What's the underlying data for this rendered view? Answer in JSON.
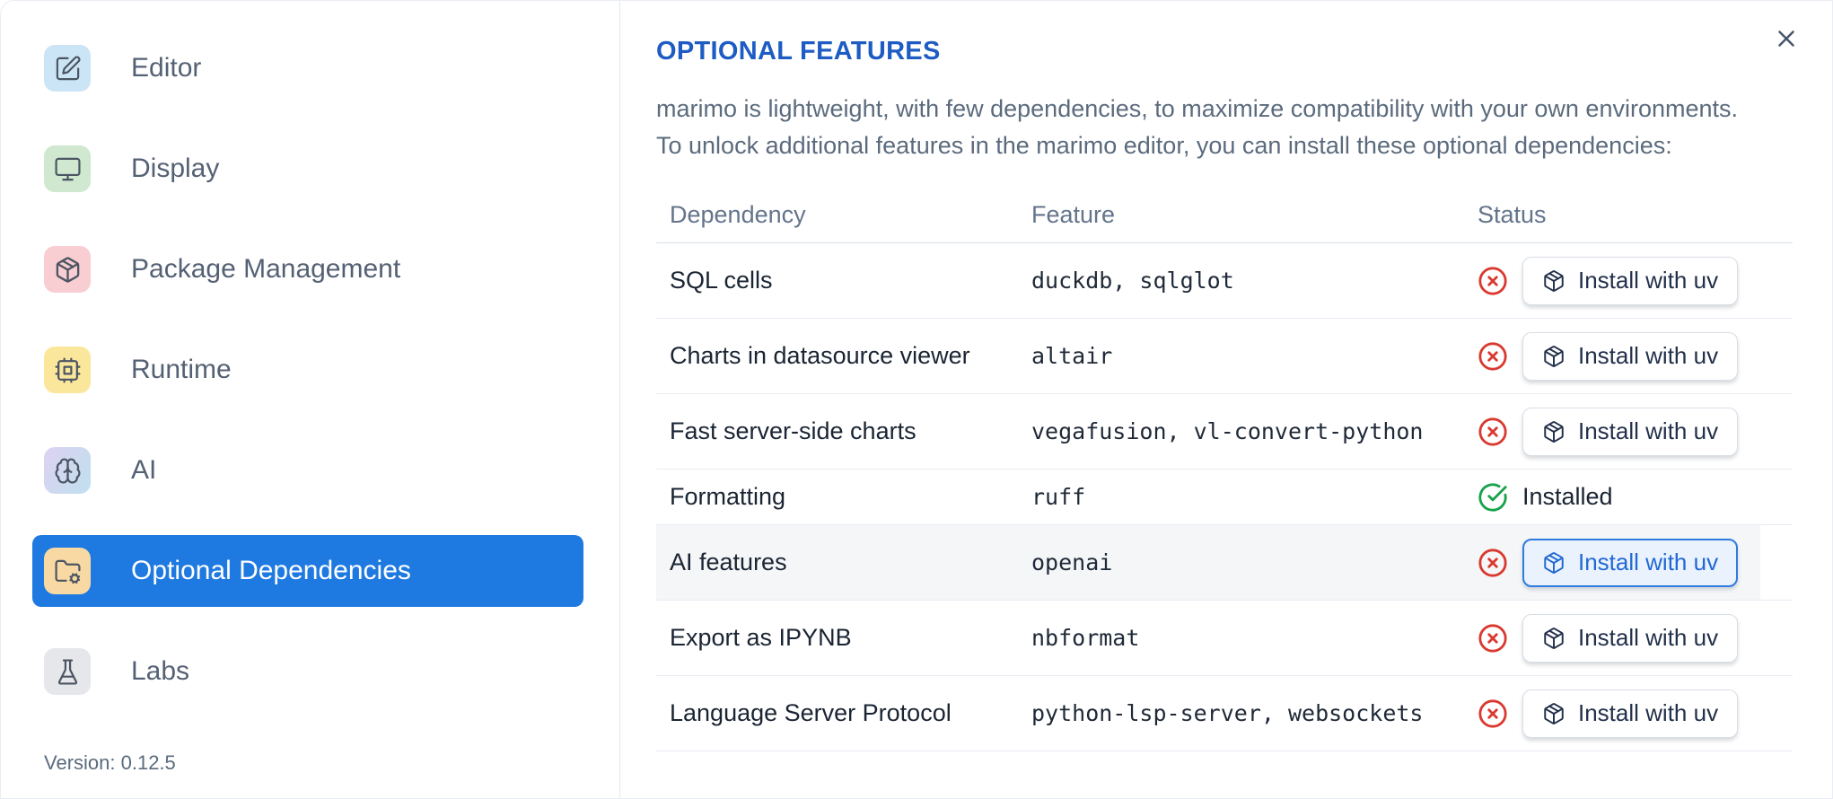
{
  "sidebar": {
    "items": [
      {
        "label": "Editor",
        "icon": "square-pen-icon",
        "icon_bg": "#cce5f6",
        "selected": false
      },
      {
        "label": "Display",
        "icon": "monitor-icon",
        "icon_bg": "#cfe8cf",
        "selected": false
      },
      {
        "label": "Package Management",
        "icon": "package-icon",
        "icon_bg": "#f9ced2",
        "selected": false
      },
      {
        "label": "Runtime",
        "icon": "cpu-icon",
        "icon_bg": "#fbe79c",
        "selected": false
      },
      {
        "label": "AI",
        "icon": "brain-icon",
        "icon_bg": "linear-gradient(120deg,#ded2f2,#bfe0ef)",
        "selected": false
      },
      {
        "label": "Optional Dependencies",
        "icon": "folder-cog-icon",
        "icon_bg": "#f8d9a4",
        "selected": true
      },
      {
        "label": "Labs",
        "icon": "flask-icon",
        "icon_bg": "#e6e7ea",
        "selected": false
      }
    ],
    "version_label": "Version: 0.12.5"
  },
  "panel": {
    "title": "OPTIONAL FEATURES",
    "description_line1": "marimo is lightweight, with few dependencies, to maximize compatibility with your own environments.",
    "description_line2": "To unlock additional features in the marimo editor, you can install these optional dependencies:",
    "close_icon": "x-icon",
    "table": {
      "columns": [
        "Dependency",
        "Feature",
        "Status"
      ],
      "rows": [
        {
          "dependency": "SQL cells",
          "feature": "duckdb, sqlglot",
          "status": "not-installed",
          "status_icon": "circle-x-icon",
          "action_label": "Install with uv",
          "action_icon": "package-icon",
          "highlighted": false
        },
        {
          "dependency": "Charts in datasource viewer",
          "feature": "altair",
          "status": "not-installed",
          "status_icon": "circle-x-icon",
          "action_label": "Install with uv",
          "action_icon": "package-icon",
          "highlighted": false
        },
        {
          "dependency": "Fast server-side charts",
          "feature": "vegafusion, vl-convert-python",
          "status": "not-installed",
          "status_icon": "circle-x-icon",
          "action_label": "Install with uv",
          "action_icon": "package-icon",
          "highlighted": false
        },
        {
          "dependency": "Formatting",
          "feature": "ruff",
          "status": "installed",
          "status_icon": "circle-check-icon",
          "installed_label": "Installed",
          "highlighted": false
        },
        {
          "dependency": "AI features",
          "feature": "openai",
          "status": "not-installed",
          "status_icon": "circle-x-icon",
          "action_label": "Install with uv",
          "action_icon": "package-icon",
          "highlighted": true
        },
        {
          "dependency": "Export as IPYNB",
          "feature": "nbformat",
          "status": "not-installed",
          "status_icon": "circle-x-icon",
          "action_label": "Install with uv",
          "action_icon": "package-icon",
          "highlighted": false
        },
        {
          "dependency": "Language Server Protocol",
          "feature": "python-lsp-server, websockets",
          "status": "not-installed",
          "status_icon": "circle-x-icon",
          "action_label": "Install with uv",
          "action_icon": "package-icon",
          "highlighted": false
        }
      ]
    }
  },
  "colors": {
    "title_blue": "#1e5cc4",
    "sidebar_selected_blue": "#1e79e0",
    "error_red": "#d93a30",
    "success_green": "#18a24b",
    "row_highlight": "#f5f6f8",
    "focused_button_bg": "#e9f2fd",
    "focused_button_border": "#2e7cdf"
  }
}
